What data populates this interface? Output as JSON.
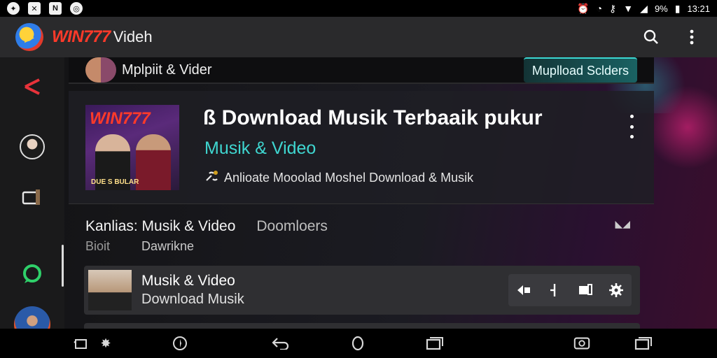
{
  "status_bar": {
    "time": "13:21",
    "battery": "9%",
    "left_icons": [
      "gear-icon",
      "close-box-icon",
      "nh-icon",
      "headset-icon"
    ],
    "right_icons": [
      "alarm-icon",
      "alarm-2-icon",
      "vpn-icon",
      "wifi-icon",
      "signal-icon",
      "battery-icon"
    ]
  },
  "app_bar": {
    "brand": "WIN777",
    "subtitle": "Videh",
    "actions": [
      "search-icon",
      "more-vert-icon"
    ]
  },
  "rail": {
    "items": [
      "close-icon",
      "profile-avatar",
      "tv-icon",
      "chat-icon",
      "user-avatar"
    ],
    "accent_color": "#e8323a"
  },
  "topstrip": {
    "title": "Mplpiit & Vider",
    "upload_label": "Muplload Sclders"
  },
  "card": {
    "thumb_brand": "WIN777",
    "thumb_caption": "DUE S BULAR",
    "title": "Download Musik Terbaaik pukur",
    "title_prefix": "ß",
    "subtitle": "Musik & Video",
    "meta": "Anlioate  Mooolad Moshel Download & Musik",
    "meta_icon": "link-icon",
    "accent_color": "#3fd6d0"
  },
  "section": {
    "title": "Kanlias: Musik & Video",
    "secondary": "Doomloers",
    "row2_a": "Bioit",
    "row2_b": "Dawrikne"
  },
  "list_item": {
    "title": "Musik & Video",
    "subtitle": "Download Musik",
    "actions": [
      "share-icon",
      "split-icon",
      "copy-icon",
      "settings-icon"
    ]
  },
  "nav_bar": {
    "buttons": [
      "screenshot-icon",
      "gear-icon",
      "compass-icon",
      "back-icon",
      "home-icon",
      "recents-icon",
      "rotate-icon",
      "recents-2-icon"
    ]
  }
}
